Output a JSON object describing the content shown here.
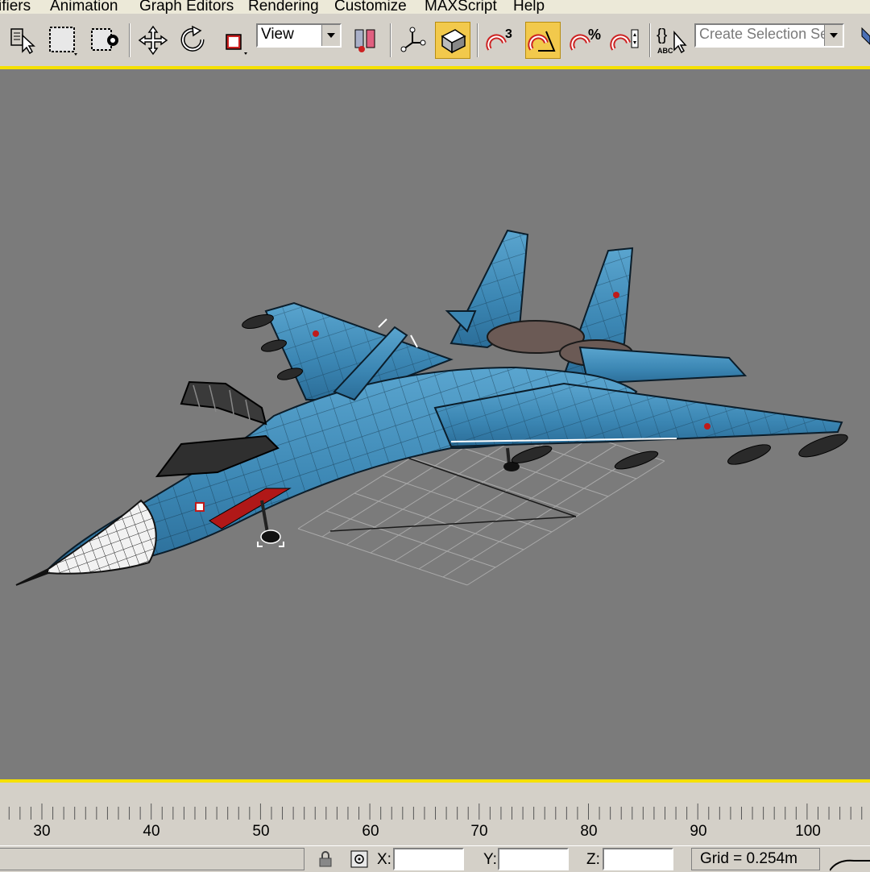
{
  "menu": {
    "items": [
      "ifiers",
      "Animation",
      "Graph Editors",
      "Rendering",
      "Customize",
      "MAXScript",
      "Help"
    ]
  },
  "toolbar": {
    "reference_coordinate": "View",
    "named_selection_placeholder": "Create Selection Set",
    "snap_label": "3",
    "active_color": "#f2c94c"
  },
  "viewport": {
    "background": "#7b7b7b",
    "highlight_border": "#f5e000",
    "model": "fighter jet wireframe"
  },
  "timeline": {
    "ticks": [
      "30",
      "40",
      "50",
      "60",
      "70",
      "80",
      "90",
      "100"
    ]
  },
  "statusbar": {
    "x_label": "X:",
    "y_label": "Y:",
    "z_label": "Z:",
    "x_value": "",
    "y_value": "",
    "z_value": "",
    "grid": "Grid = 0.254m"
  }
}
